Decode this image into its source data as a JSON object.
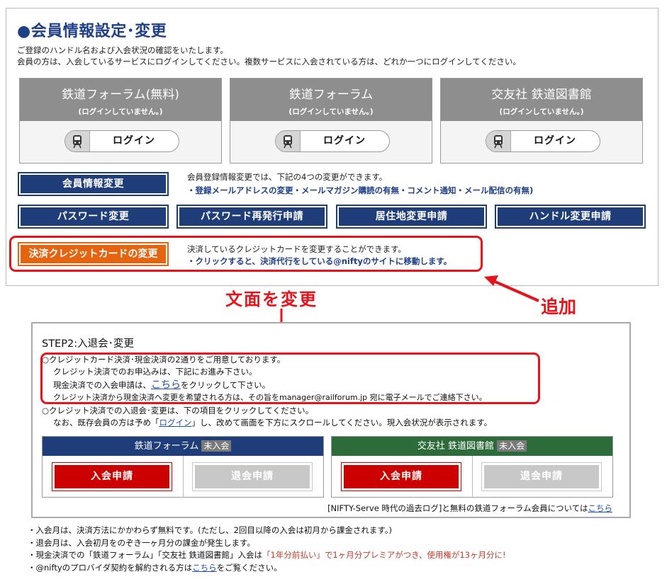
{
  "header": {
    "title": "●会員情報設定･変更",
    "intro_line1": "ご登録のハンドル名および入会状況の確認をいたします。",
    "intro_line2": "会員の方は、入会しているサービスにログインしてください。複数サービスに入会されている方は、どれか一つにログインしてください。"
  },
  "services": [
    {
      "name": "鉄道フォーラム(無料)",
      "status": "(ログインしていません。)",
      "login_label": "ログイン"
    },
    {
      "name": "鉄道フォーラム",
      "status": "(ログインしていません。)",
      "login_label": "ログイン"
    },
    {
      "name": "交友社 鉄道図書館",
      "status": "(ログインしていません。)",
      "login_label": "ログイン"
    }
  ],
  "member_change": {
    "button_label": "会員情報変更",
    "desc_line1": "会員登録情報変更では、下記の4つの変更ができます。",
    "desc_line2": "・登録メールアドレスの変更・メールマガジン購読の有無・コメント通知・メール配信の有無)"
  },
  "buttons": {
    "password_change": "パスワード変更",
    "password_reissue": "パスワード再発行申請",
    "address_change": "居住地変更申請",
    "handle_change": "ハンドル変更申請"
  },
  "credit": {
    "button_label": "決済クレジットカードの変更",
    "desc_line1": "決済しているクレジットカードを変更することができます。",
    "desc_line2": "・クリックすると、決済代行をしている@niftyのサイトに移動します。"
  },
  "annotations": {
    "text_change": "文面を変更",
    "added": "追加",
    "color": "#e8121a"
  },
  "step2": {
    "title": "STEP2:入退会･変更",
    "line1": "○クレジットカード決済･現金決済の2通りをご用意しております。",
    "line2": "クレジット決済でのお申込みは、下記にお進み下さい。",
    "line3_pre": "現金決済での入会申請は、",
    "line3_link": "こちら",
    "line3_post": "をクリックして下さい。",
    "line4": "クレジット決済から現金決済へ変更を希望される方は、その旨をmanager@railforum.jp 宛に電子メールでご連絡下さい。",
    "line5": "○クレジット決済での入退会･変更は、下の項目をクリックしてください。",
    "line6_pre": "なお、既存会員の方は予め「",
    "line6_link": "ログイン",
    "line6_post": "」し、改めて画面を下方にスクロールしてください。現入会状況が表示されます。",
    "boxes": [
      {
        "name": "鉄道フォーラム",
        "tag": "未入会",
        "join": "入会申請",
        "leave": "退会申請",
        "color": "#1f3d78"
      },
      {
        "name": "交友社 鉄道図書館",
        "tag": "未入会",
        "join": "入会申請",
        "leave": "退会申請",
        "color": "#2e6b3a"
      }
    ],
    "archive_pre": "[NIFTY-Serve 時代の過去ログ]と無料の鉄道フォーラム会員については",
    "archive_link": "こちら"
  },
  "footer": {
    "line1": "・入会月は、決済方法にかかわらず無料です。(ただし、2回目以降の入会は初月から課金されます。)",
    "line2": "・退会月は、入会初月をのぞき一ヶ月分の課金が発生します。",
    "line3_pre": "・現金決済での「鉄道フォーラム」「交友社 鉄道図書館」入会は",
    "line3_red": "「1年分前払い」で1ヶ月分プレミアがつき、使用権が13ヶ月分に!",
    "line4_pre": "・@niftyのプロバイダ契約を解約される方は",
    "line4_link": "こちら",
    "line4_post": "をご覧ください。"
  }
}
